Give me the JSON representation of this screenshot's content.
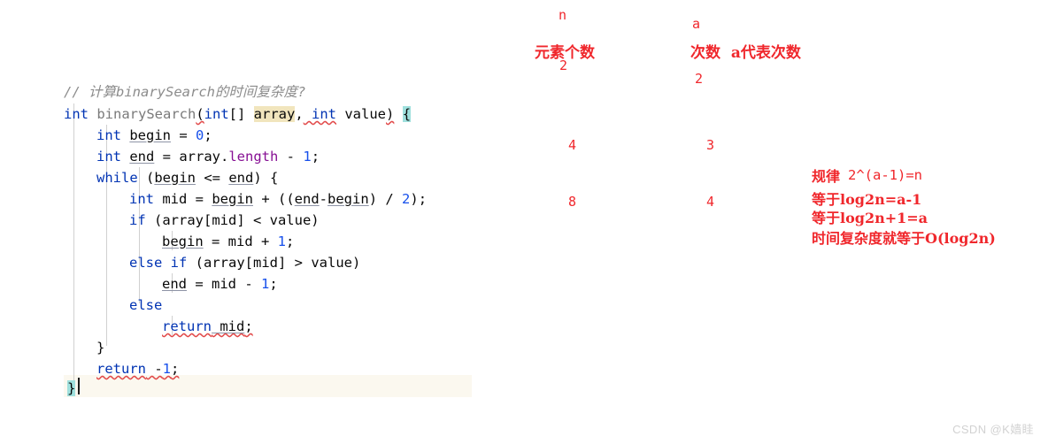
{
  "editor": {
    "comment": "// 计算binarySearch的时间复杂度?",
    "lines": {
      "l1_a": "int",
      "l1_b": " binarySearch",
      "l1_c": "(",
      "l1_d": "int",
      "l1_e": "[] ",
      "l1_f": "array",
      "l1_g": ",",
      "l1_h": " int",
      "l1_i": " value",
      "l1_j": ")",
      "l1_k": " ",
      "l1_l": "{",
      "l2_a": "int",
      "l2_b": " ",
      "l2_c": "begin",
      "l2_d": " = ",
      "l2_e": "0",
      "l2_f": ";",
      "l3_a": "int",
      "l3_b": " ",
      "l3_c": "end",
      "l3_d": " = array.",
      "l3_e": "length",
      "l3_f": " - ",
      "l3_g": "1",
      "l3_h": ";",
      "l4_a": "while",
      "l4_b": " (",
      "l4_c": "begin",
      "l4_d": " <= ",
      "l4_e": "end",
      "l4_f": ") {",
      "l5_a": "int",
      "l5_b": " mid = ",
      "l5_c": "begin",
      "l5_d": " + ((",
      "l5_e": "end",
      "l5_f": "-",
      "l5_g": "begin",
      "l5_h": ") / ",
      "l5_i": "2",
      "l5_j": ");",
      "l6_a": "if",
      "l6_b": " (array[mid] < value)",
      "l7_a": "begin",
      "l7_b": " = mid + ",
      "l7_c": "1",
      "l7_d": ";",
      "l8_a": "else",
      "l8_b": " ",
      "l8_c": "if",
      "l8_d": " (array[mid] > value)",
      "l9_a": "end",
      "l9_b": " = mid - ",
      "l9_c": "1",
      "l9_d": ";",
      "l10_a": "else",
      "l11_a": "return",
      "l11_b": " mid",
      "l11_c": ";",
      "l12_a": "}",
      "l13_a": "return",
      "l13_b": " -",
      "l13_c": "1",
      "l13_d": ";",
      "l14_a": "}"
    }
  },
  "annotations": {
    "col_n": {
      "symbol": "n",
      "label": "元素个数",
      "values": [
        "2",
        "4",
        "8"
      ]
    },
    "col_a": {
      "symbol": "a",
      "label": "次数  a代表次数",
      "values": [
        "2",
        "3",
        "4"
      ]
    },
    "formula": {
      "title_cn": "规律",
      "title_expr": "2^(a-1)=n",
      "line2": "等于log2n=a-1",
      "line3": "等于log2n+1=a",
      "line4": "时间复杂度就等于O(log2n)"
    }
  },
  "watermark": "CSDN @K嫱眭",
  "colors": {
    "annotation_red": "#f0272c",
    "keyword_blue": "#0033b3",
    "number_blue": "#1750eb",
    "field_purple": "#871094",
    "comment_gray": "#8c8c8c",
    "highlight_yellow": "#f1e5bd",
    "highlight_cyan": "#9fe0dd",
    "current_line": "#fbf8ef"
  }
}
